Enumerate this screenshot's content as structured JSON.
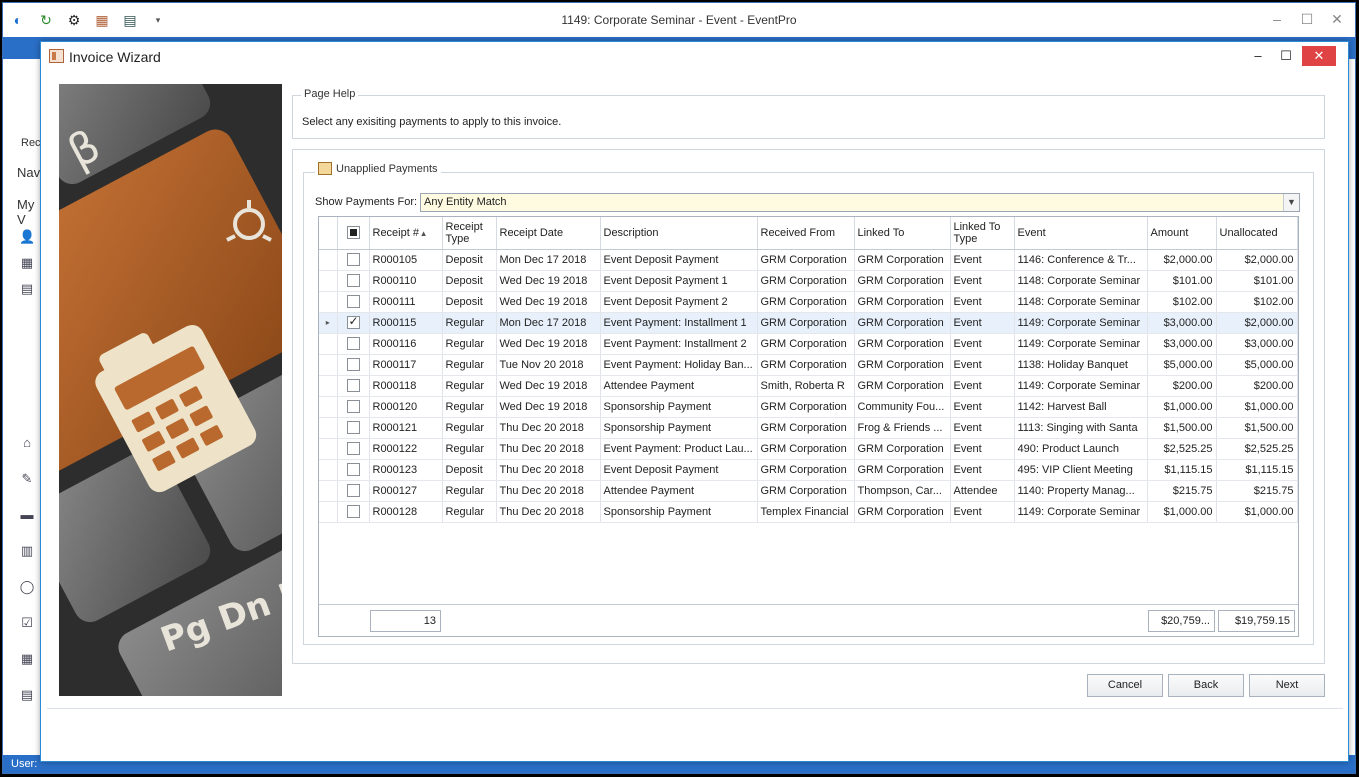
{
  "app": {
    "title": "1149: Corporate Seminar - Event - EventPro",
    "left_labels": [
      "Rec",
      "Nav",
      "My V"
    ],
    "status_text": "User:"
  },
  "dialog": {
    "title": "Invoice Wizard"
  },
  "page_help": {
    "group_title": "Page Help",
    "text": "Select any exisiting payments to apply to this invoice."
  },
  "payments": {
    "group_title": "Unapplied Payments",
    "filter_label": "Show Payments For:",
    "filter_value": "Any Entity Match",
    "columns": [
      "Receipt #",
      "Receipt Type",
      "Receipt Date",
      "Description",
      "Received From",
      "Linked To",
      "Linked To Type",
      "Event",
      "Amount",
      "Unallocated"
    ],
    "rows": [
      {
        "checked": false,
        "focused": false,
        "receipt": "R000105",
        "type": "Deposit",
        "date": "Mon Dec 17 2018",
        "description": "Event Deposit Payment",
        "received_from": "GRM Corporation",
        "linked_to": "GRM Corporation",
        "linked_type": "Event",
        "event": "1146: Conference & Tr...",
        "amount": "$2,000.00",
        "unallocated": "$2,000.00"
      },
      {
        "checked": false,
        "focused": false,
        "receipt": "R000110",
        "type": "Deposit",
        "date": "Wed Dec 19 2018",
        "description": "Event Deposit Payment 1",
        "received_from": "GRM Corporation",
        "linked_to": "GRM Corporation",
        "linked_type": "Event",
        "event": "1148: Corporate Seminar",
        "amount": "$101.00",
        "unallocated": "$101.00"
      },
      {
        "checked": false,
        "focused": false,
        "receipt": "R000111",
        "type": "Deposit",
        "date": "Wed Dec 19 2018",
        "description": "Event Deposit Payment 2",
        "received_from": "GRM Corporation",
        "linked_to": "GRM Corporation",
        "linked_type": "Event",
        "event": "1148: Corporate Seminar",
        "amount": "$102.00",
        "unallocated": "$102.00"
      },
      {
        "checked": true,
        "focused": true,
        "receipt": "R000115",
        "type": "Regular",
        "date": "Mon Dec 17 2018",
        "description": "Event Payment: Installment 1",
        "received_from": "GRM Corporation",
        "linked_to": "GRM Corporation",
        "linked_type": "Event",
        "event": "1149: Corporate Seminar",
        "amount": "$3,000.00",
        "unallocated": "$2,000.00"
      },
      {
        "checked": false,
        "focused": false,
        "receipt": "R000116",
        "type": "Regular",
        "date": "Wed Dec 19 2018",
        "description": "Event Payment: Installment 2",
        "received_from": "GRM Corporation",
        "linked_to": "GRM Corporation",
        "linked_type": "Event",
        "event": "1149: Corporate Seminar",
        "amount": "$3,000.00",
        "unallocated": "$3,000.00"
      },
      {
        "checked": false,
        "focused": false,
        "receipt": "R000117",
        "type": "Regular",
        "date": "Tue Nov 20 2018",
        "description": "Event Payment: Holiday Ban...",
        "received_from": "GRM Corporation",
        "linked_to": "GRM Corporation",
        "linked_type": "Event",
        "event": "1138: Holiday Banquet",
        "amount": "$5,000.00",
        "unallocated": "$5,000.00"
      },
      {
        "checked": false,
        "focused": false,
        "receipt": "R000118",
        "type": "Regular",
        "date": "Wed Dec 19 2018",
        "description": "Attendee Payment",
        "received_from": "Smith, Roberta R",
        "linked_to": "GRM Corporation",
        "linked_type": "Event",
        "event": "1149: Corporate Seminar",
        "amount": "$200.00",
        "unallocated": "$200.00"
      },
      {
        "checked": false,
        "focused": false,
        "receipt": "R000120",
        "type": "Regular",
        "date": "Wed Dec 19 2018",
        "description": "Sponsorship Payment",
        "received_from": "GRM Corporation",
        "linked_to": "Community Fou...",
        "linked_type": "Event",
        "event": "1142: Harvest Ball",
        "amount": "$1,000.00",
        "unallocated": "$1,000.00"
      },
      {
        "checked": false,
        "focused": false,
        "receipt": "R000121",
        "type": "Regular",
        "date": "Thu Dec 20 2018",
        "description": "Sponsorship Payment",
        "received_from": "GRM Corporation",
        "linked_to": "Frog & Friends ...",
        "linked_type": "Event",
        "event": "1113: Singing with Santa",
        "amount": "$1,500.00",
        "unallocated": "$1,500.00"
      },
      {
        "checked": false,
        "focused": false,
        "receipt": "R000122",
        "type": "Regular",
        "date": "Thu Dec 20 2018",
        "description": "Event Payment: Product Lau...",
        "received_from": "GRM Corporation",
        "linked_to": "GRM Corporation",
        "linked_type": "Event",
        "event": "490: Product Launch",
        "amount": "$2,525.25",
        "unallocated": "$2,525.25"
      },
      {
        "checked": false,
        "focused": false,
        "receipt": "R000123",
        "type": "Deposit",
        "date": "Thu Dec 20 2018",
        "description": "Event Deposit Payment",
        "received_from": "GRM Corporation",
        "linked_to": "GRM Corporation",
        "linked_type": "Event",
        "event": "495: VIP Client Meeting",
        "amount": "$1,115.15",
        "unallocated": "$1,115.15"
      },
      {
        "checked": false,
        "focused": false,
        "receipt": "R000127",
        "type": "Regular",
        "date": "Thu Dec 20 2018",
        "description": "Attendee Payment",
        "received_from": "GRM Corporation",
        "linked_to": "Thompson, Car...",
        "linked_type": "Attendee",
        "event": "1140: Property Manag...",
        "amount": "$215.75",
        "unallocated": "$215.75"
      },
      {
        "checked": false,
        "focused": false,
        "receipt": "R000128",
        "type": "Regular",
        "date": "Thu Dec 20 2018",
        "description": "Sponsorship Payment",
        "received_from": "Templex Financial",
        "linked_to": "GRM Corporation",
        "linked_type": "Event",
        "event": "1149: Corporate Seminar",
        "amount": "$1,000.00",
        "unallocated": "$1,000.00"
      }
    ],
    "footer": {
      "count": "13",
      "amount_total": "$20,759...",
      "unallocated_total": "$19,759.15"
    }
  },
  "buttons": {
    "cancel": "Cancel",
    "back": "Back",
    "next": "Next"
  },
  "colors": {
    "accent": "#2a6fc7",
    "close": "#e04343",
    "focused_row": "#e8f1fb",
    "filter_bg": "#fffbe0"
  }
}
